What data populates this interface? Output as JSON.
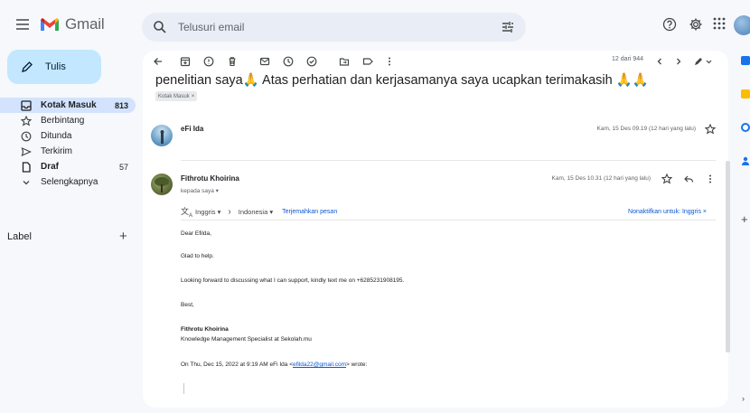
{
  "app": {
    "name": "Gmail"
  },
  "search": {
    "placeholder": "Telusuri email"
  },
  "sidebar": {
    "compose_label": "Tulis",
    "items": [
      {
        "label": "Kotak Masuk",
        "count": "813",
        "icon": "inbox-icon",
        "active": true
      },
      {
        "label": "Berbintang",
        "count": "",
        "icon": "star-icon"
      },
      {
        "label": "Ditunda",
        "count": "",
        "icon": "clock-icon"
      },
      {
        "label": "Terkirim",
        "count": "",
        "icon": "send-icon"
      },
      {
        "label": "Draf",
        "count": "57",
        "icon": "draft-icon",
        "bold": true
      },
      {
        "label": "Selengkapnya",
        "count": "",
        "icon": "chevron-down-icon"
      }
    ],
    "label_heading": "Label",
    "label_add": "+"
  },
  "toolbar": {
    "pager": "12 dari 944"
  },
  "thread": {
    "subject": "penelitian saya🙏 Atas perhatian dan kerjasamanya saya ucapkan terimakasih 🙏🙏",
    "chip_label": "Kotak Masuk",
    "chip_close": "×"
  },
  "messages": [
    {
      "sender": "eFi Ida",
      "date": "Kam, 15 Des 09.19 (12 hari yang lalu)"
    },
    {
      "sender": "Fithrotu Khoirina",
      "to": "kepada saya ▾",
      "date": "Kam, 15 Des 10.31 (12 hari yang lalu)",
      "translate": {
        "from_lang": "Inggris ▾",
        "arrow": "›",
        "to_lang": "Indonesia ▾",
        "link": "Terjemahkan pesan",
        "disable": "Nonaktifkan untuk: Inggris ×"
      },
      "body": {
        "greeting": "Dear Efilda,",
        "line1": "Glad to help.",
        "line2": "Looking forward to discussing what I can support, kindly text me on +6285231908195.",
        "closing": "Best,",
        "sig_name": "Fithrotu Khoirina",
        "sig_title": "Knowledge Management Specialist at Sekolah.mu",
        "quote_prefix": "On Thu, Dec 15, 2022 at 9:19 AM eFi Ida <",
        "quote_email": "efilda22@gmail.com",
        "quote_suffix": "> wrote:"
      }
    }
  ],
  "rail": {
    "chevron": "›",
    "plus": "+"
  },
  "colors": {
    "compose": "#c2e7ff",
    "active_nav": "#d3e3fd",
    "link": "#0b57d0",
    "background": "#f6f8fc"
  }
}
